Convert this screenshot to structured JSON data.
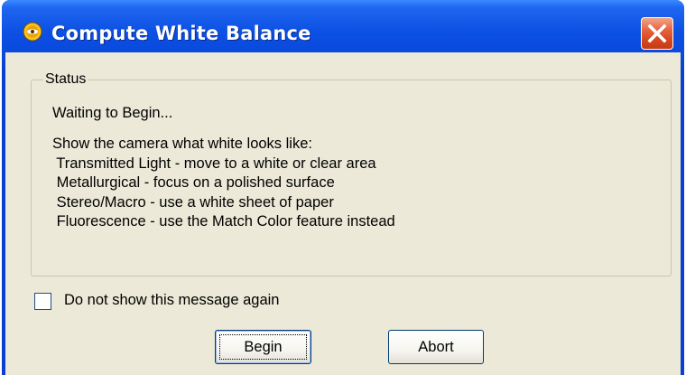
{
  "window": {
    "title": "Compute White Balance",
    "icon": "app-emblem-icon",
    "close_icon": "close-x-icon",
    "title_color": "#0a49db",
    "close_color": "#d6481f"
  },
  "status_group": {
    "legend": "Status",
    "status_text": "Waiting to Begin...",
    "instructions": [
      "Show the camera what white looks like:",
      " Transmitted Light - move to a white or clear area",
      " Metallurgical - focus on a polished surface",
      " Stereo/Macro - use a white sheet of paper",
      " Fluorescence - use the Match Color feature instead"
    ]
  },
  "checkbox": {
    "label": "Do not show this message again",
    "checked": false
  },
  "buttons": {
    "begin": "Begin",
    "abort": "Abort"
  }
}
